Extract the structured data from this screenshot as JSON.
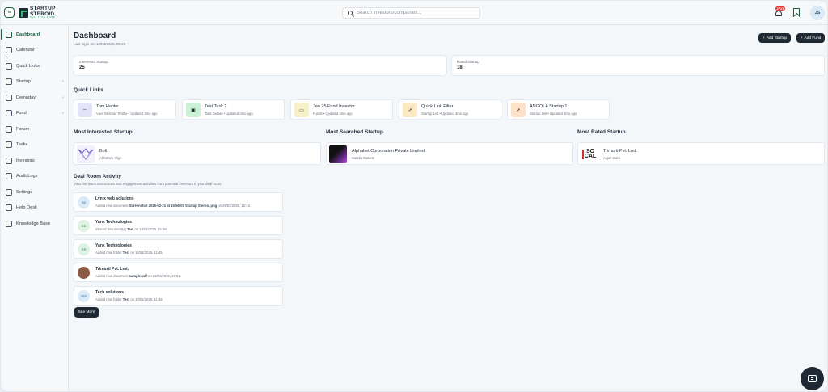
{
  "header": {
    "logo_line1": "STARTUP",
    "logo_line2": "STEROID",
    "logo_tagline": "DEAL FLOW & CRM",
    "search_placeholder": "Search investors/companies...",
    "notification_count": "2721",
    "user_initials": "JS"
  },
  "sidebar": {
    "items": [
      {
        "label": "Dashboard",
        "icon": "dashboard-icon",
        "active": true
      },
      {
        "label": "Calendar",
        "icon": "calendar-icon"
      },
      {
        "label": "Quick Links",
        "icon": "external-link-icon"
      },
      {
        "label": "Startup",
        "icon": "startup-icon",
        "has_children": true
      },
      {
        "label": "Demoday",
        "icon": "demoday-icon",
        "has_children": true
      },
      {
        "label": "Fund",
        "icon": "fund-icon",
        "has_children": true
      },
      {
        "label": "Forum",
        "icon": "forum-icon"
      },
      {
        "label": "Tasks",
        "icon": "tasks-icon"
      },
      {
        "label": "Investors",
        "icon": "investors-icon"
      },
      {
        "label": "Audit Logs",
        "icon": "audit-logs-icon"
      },
      {
        "label": "Settings",
        "icon": "settings-icon"
      },
      {
        "label": "Help Desk",
        "icon": "help-desk-icon"
      },
      {
        "label": "Knowledge Base",
        "icon": "knowledge-base-icon"
      }
    ]
  },
  "main": {
    "title": "Dashboard",
    "last_login": "Last login on: 12/04/2025, 00:22",
    "add_startup_label": "Add Startup",
    "add_fund_label": "Add Fund",
    "stats": [
      {
        "label": "Interested Startup",
        "value": "25"
      },
      {
        "label": "Rated Startup",
        "value": "18"
      }
    ],
    "quick_links_title": "Quick Links",
    "quick_links": [
      {
        "title": "Tom Hanks",
        "subtitle": "View Member Profile • Updated 3mo ago",
        "icon": "link-icon",
        "color": "#e3e3f7"
      },
      {
        "title": "Test Task 2",
        "subtitle": "Task Details • Updated 3mo ago",
        "icon": "task-icon",
        "color": "#c9f1d4"
      },
      {
        "title": "Jan 25 Fund Investor",
        "subtitle": "Funds • Updated 3mo ago",
        "icon": "fund-icon",
        "color": "#f7f1c8"
      },
      {
        "title": "Quick Link Filter",
        "subtitle": "Startup List • Updated 3mo ago",
        "icon": "rocket-icon",
        "color": "#fde8c4"
      },
      {
        "title": "ANGOLA Startup 1",
        "subtitle": "Startup List • Updated 4mo ago",
        "icon": "rocket-icon",
        "color": "#fde1c8"
      }
    ],
    "most_interested": {
      "heading": "Most Interested Startup",
      "name": "Bolt",
      "person": "Abhishek Align"
    },
    "most_searched": {
      "heading": "Most Searched Startup",
      "name": "Alphabet Corporation Private Limited",
      "person": "Sandip Mutant"
    },
    "most_rated": {
      "heading": "Most Rated Startup",
      "name": "Trimurti Pvt. Lmt.",
      "person": "Anjali Saini",
      "logo_text": "SO CAL"
    },
    "deal_room": {
      "title": "Deal Room Activity",
      "subtitle": "View the latest interactions and engagement activities from potential investors in your deal room.",
      "items": [
        {
          "avatar": "np",
          "name": "Lynix web solutions",
          "pre": "Added new document",
          "object": "Screenshot 2025-02-21 at 15-56-07 Startup Steroid.png",
          "post": "on 26/02/2025, 15:42.",
          "avatar_bg": "#dcebf8",
          "avatar_fg": "#3b6d99"
        },
        {
          "avatar": "SS",
          "name": "Yank Technologies",
          "pre": "Shared document(s)",
          "object": "Test",
          "post": "on 14/01/2025, 11:46.",
          "avatar_bg": "#dff3e4",
          "avatar_fg": "#3b8a55"
        },
        {
          "avatar": "SS",
          "name": "Yank Technologies",
          "pre": "Added new folder",
          "object": "Test",
          "post": "on 14/01/2025, 11:45.",
          "avatar_bg": "#dff3e4",
          "avatar_fg": "#3b8a55"
        },
        {
          "avatar": "",
          "name": "Trimurti Pvt. Lmt.",
          "pre": "Added new document",
          "object": "sample.pdf",
          "post": "on 13/01/2025, 17:51.",
          "avatar_bg": "#8a5a44",
          "avatar_fg": "#fff"
        },
        {
          "avatar": "SM",
          "name": "Tech solutions",
          "pre": "Added new folder",
          "object": "Test",
          "post": "on 10/01/2025, 11:48.",
          "avatar_bg": "#dcebf8",
          "avatar_fg": "#3b6d99"
        }
      ],
      "see_more_label": "See More"
    }
  },
  "colors": {
    "accent": "#1d5c45",
    "dark_button": "#1f2933",
    "badge": "#e53935"
  }
}
